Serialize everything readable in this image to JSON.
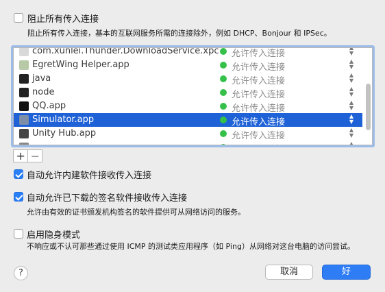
{
  "options": {
    "block_all": {
      "label": "阻止所有传入连接",
      "desc": "阻止所有传入连接，基本的互联网服务所需的连接除外，例如 DHCP、Bonjour 和 IPSec。",
      "checked": false
    },
    "auto_builtin": {
      "label": "自动允许内建软件接收传入连接",
      "checked": true
    },
    "auto_signed": {
      "label": "自动允许已下载的签名软件接收传入连接",
      "desc": "允许由有效的证书颁发机构签名的软件提供可从网络访问的服务。",
      "checked": true
    },
    "stealth": {
      "label": "启用隐身模式",
      "desc": "不响应或不认可那些通过使用 ICMP 的测试类应用程序（如 Ping）从网络对这台电脑的访问尝试。",
      "checked": false
    }
  },
  "apps": [
    {
      "name": "com.xunlei.Thunder.DownloadService.xpc",
      "status": "允许传入连接",
      "icon_color": "#d9d9d9",
      "icon_name": "xpc-icon"
    },
    {
      "name": "EgretWing Helper.app",
      "status": "允许传入连接",
      "icon_color": "#b7c9a6",
      "icon_name": "egretwing-icon"
    },
    {
      "name": "java",
      "status": "允许传入连接",
      "icon_color": "#222222",
      "icon_name": "terminal-icon"
    },
    {
      "name": "node",
      "status": "允许传入连接",
      "icon_color": "#222222",
      "icon_name": "terminal-icon"
    },
    {
      "name": "QQ.app",
      "status": "允许传入连接",
      "icon_color": "#111111",
      "icon_name": "qq-penguin-icon"
    },
    {
      "name": "Simulator.app",
      "status": "允许传入连接",
      "icon_color": "#7d8fa8",
      "icon_name": "simulator-icon",
      "selected": true
    },
    {
      "name": "Unity Hub.app",
      "status": "允许传入连接",
      "icon_color": "#444444",
      "icon_name": "unity-icon"
    },
    {
      "name": "",
      "status": "允许传入连接",
      "icon_color": "#888888",
      "icon_name": "app-icon"
    }
  ],
  "list_controls": {
    "add": "+",
    "remove": "—"
  },
  "buttons": {
    "help": "?",
    "cancel": "取消",
    "ok": "好"
  },
  "colors": {
    "accent": "#2f7df5",
    "selection": "#1f62d7",
    "status_green": "#35c04a"
  }
}
